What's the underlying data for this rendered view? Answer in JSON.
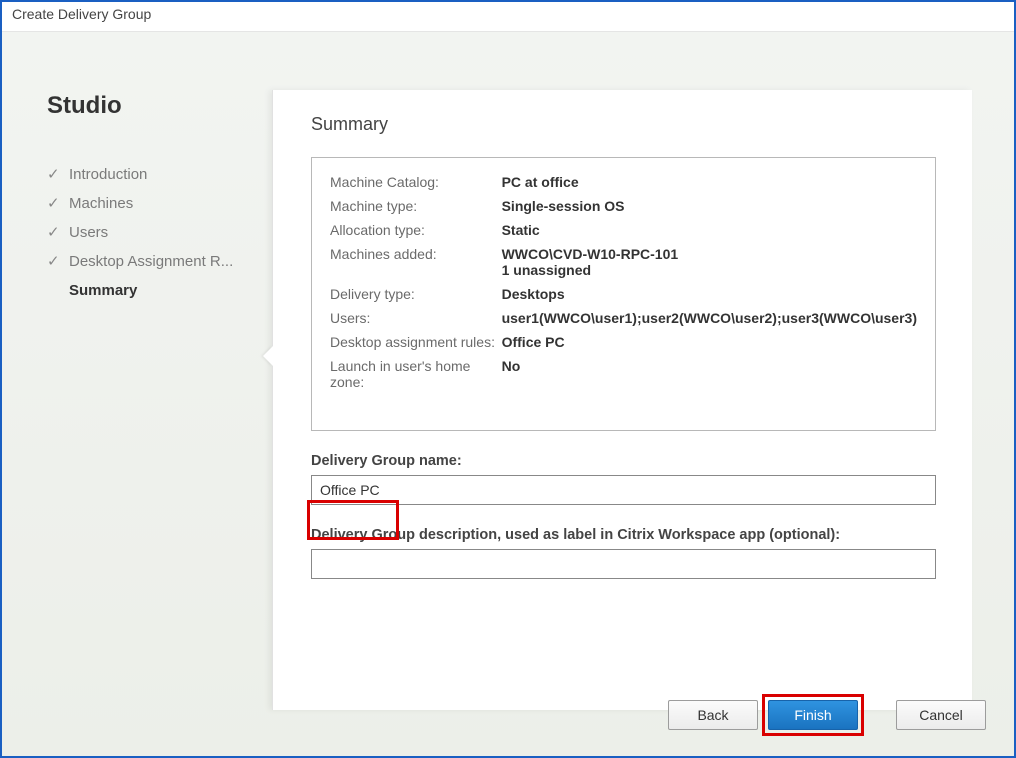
{
  "window": {
    "title": "Create Delivery Group"
  },
  "sidebar": {
    "product": "Studio",
    "items": [
      {
        "label": "Introduction",
        "done": true
      },
      {
        "label": "Machines",
        "done": true
      },
      {
        "label": "Users",
        "done": true
      },
      {
        "label": "Desktop Assignment R...",
        "done": true
      },
      {
        "label": "Summary",
        "current": true
      }
    ]
  },
  "panel": {
    "heading": "Summary",
    "rows": [
      {
        "label": "Machine Catalog:",
        "value": "PC at office"
      },
      {
        "label": "Machine type:",
        "value": "Single-session OS"
      },
      {
        "label": "Allocation type:",
        "value": "Static"
      },
      {
        "label": "Machines added:",
        "value": "WWCO\\CVD-W10-RPC-101\n1 unassigned"
      },
      {
        "label": "Delivery type:",
        "value": "Desktops"
      },
      {
        "label": "Users:",
        "value": "user1(WWCO\\user1);user2(WWCO\\user2);user3(WWCO\\user3)"
      },
      {
        "label": "Desktop assignment rules:",
        "value": "Office PC"
      },
      {
        "label": "Launch in user's home zone:",
        "value": "No"
      }
    ],
    "name_label": "Delivery Group name:",
    "name_value": "Office PC",
    "desc_label": "Delivery Group description, used as label in Citrix Workspace app (optional):",
    "desc_value": ""
  },
  "buttons": {
    "back": "Back",
    "finish": "Finish",
    "cancel": "Cancel"
  }
}
